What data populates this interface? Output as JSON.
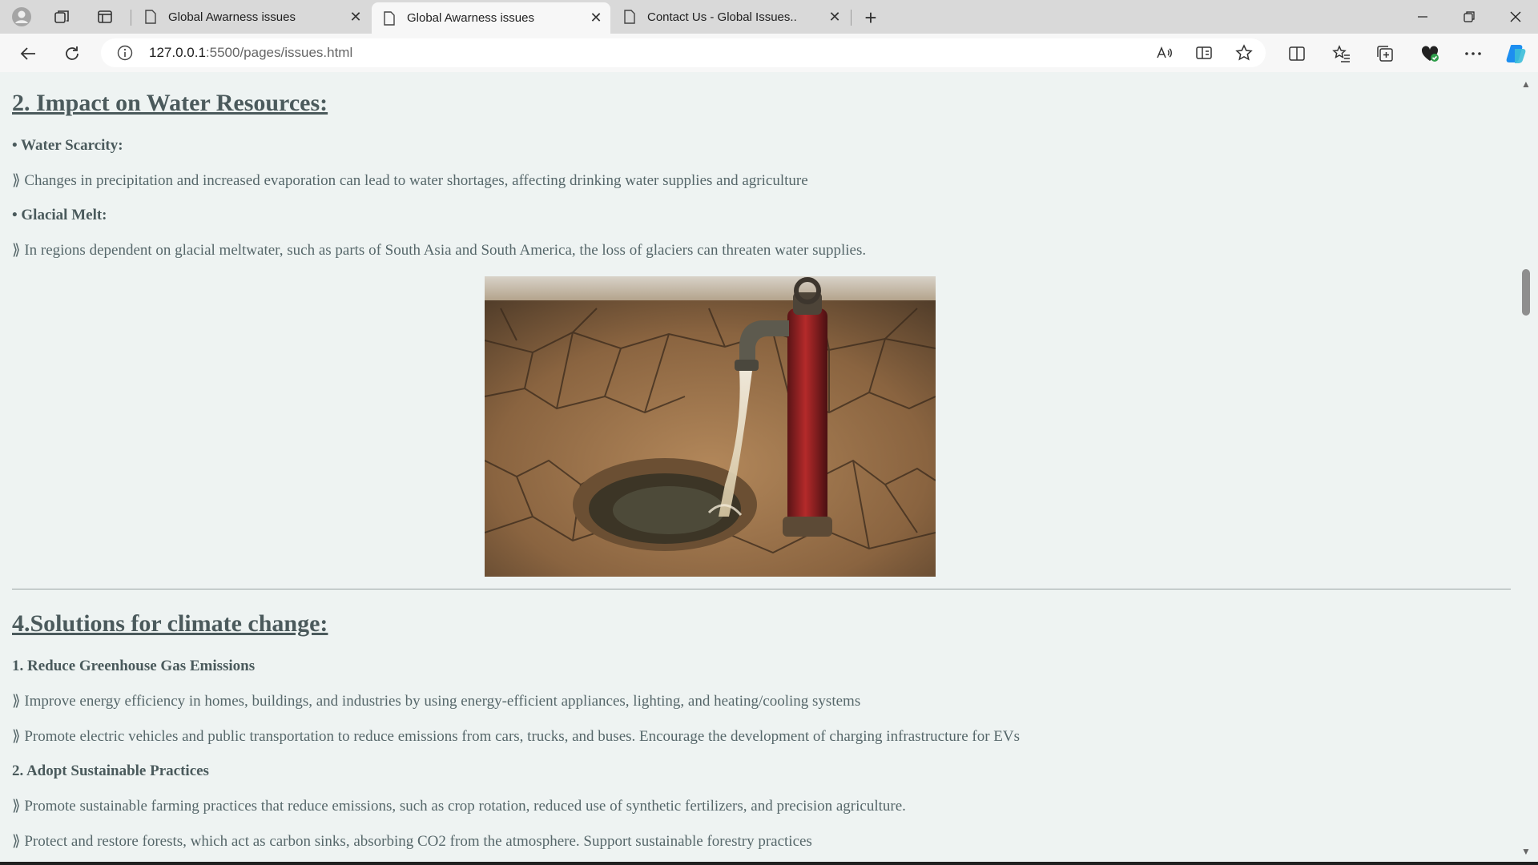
{
  "browser": {
    "tabs": [
      {
        "title": "Global Awarness issues",
        "active": false
      },
      {
        "title": "Global Awarness issues",
        "active": true
      },
      {
        "title": "Contact Us - Global Issues..",
        "active": false
      }
    ],
    "url_host": "127.0.0.1",
    "url_rest": ":5500/pages/issues.html",
    "accent_color": "#1a73e8"
  },
  "page": {
    "water": {
      "heading": "2. Impact on Water Resources:",
      "items": [
        {
          "label": "• Water Scarcity:",
          "text": "⟫ Changes in precipitation and increased evaporation can lead to water shortages, affecting drinking water supplies and agriculture"
        },
        {
          "label": "• Glacial Melt:",
          "text": "⟫ In regions dependent on glacial meltwater, such as parts of South Asia and South America, the loss of glaciers can threaten water supplies."
        }
      ]
    },
    "solutions": {
      "heading": "4.Solutions for climate change:",
      "sub1": "1. Reduce Greenhouse Gas Emissions",
      "sub1_points": [
        "⟫ Improve energy efficiency in homes, buildings, and industries by using energy-efficient appliances, lighting, and heating/cooling systems",
        "⟫ Promote electric vehicles and public transportation to reduce emissions from cars, trucks, and buses. Encourage the development of charging infrastructure for EVs"
      ],
      "sub2": "2. Adopt Sustainable Practices",
      "sub2_points": [
        "⟫ Promote sustainable farming practices that reduce emissions, such as crop rotation, reduced use of synthetic fertilizers, and precision agriculture.",
        "⟫ Protect and restore forests, which act as carbon sinks, absorbing CO2 from the atmosphere. Support sustainable forestry practices"
      ]
    }
  }
}
